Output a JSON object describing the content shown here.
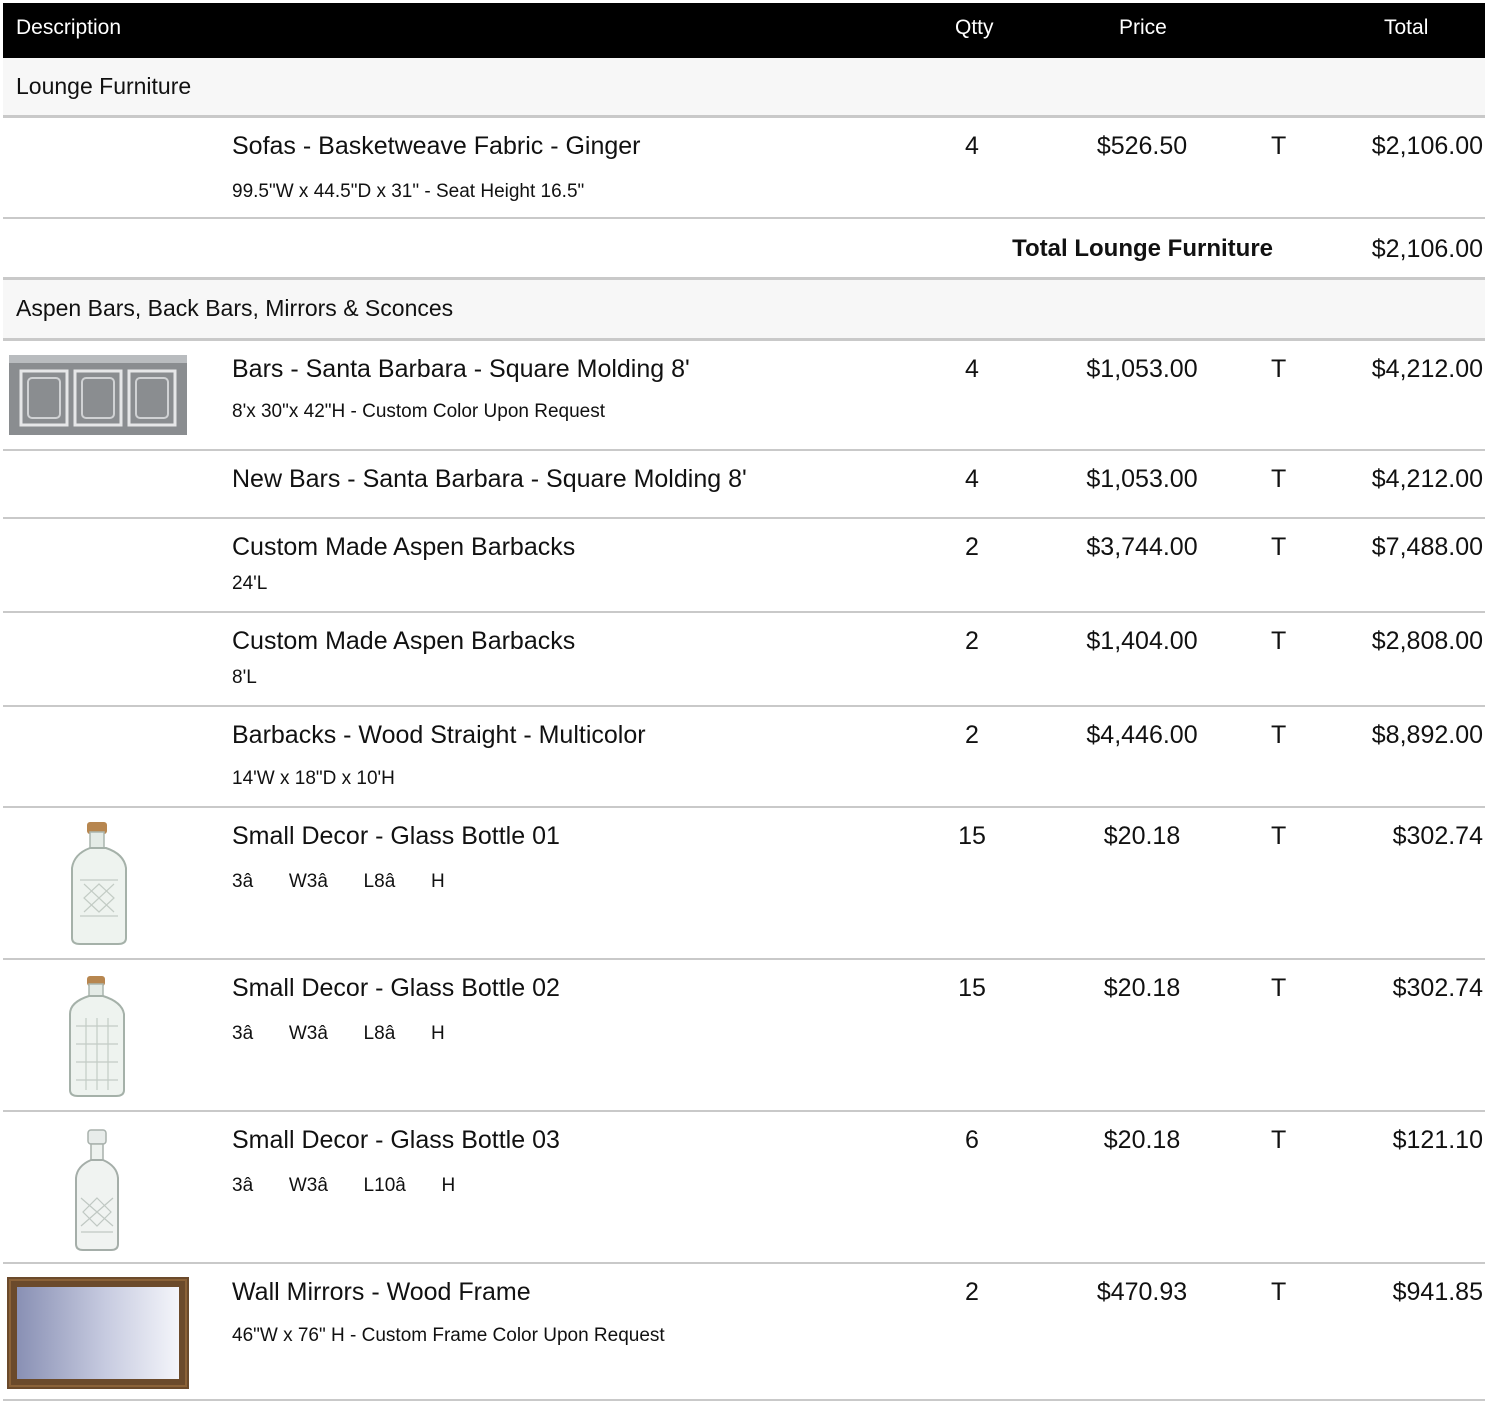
{
  "header": {
    "description": "Description",
    "qty": "Qtty",
    "price": "Price",
    "total": "Total"
  },
  "sections": [
    {
      "title": "Lounge Furniture",
      "items": [
        {
          "name": "Sofas - Basketweave Fabric - Ginger",
          "dims": "99.5\"W x 44.5\"D x 31\" - Seat Height 16.5\"",
          "qty": "4",
          "price": "$526.50",
          "tax": "T",
          "total": "$2,106.00",
          "image": "none"
        }
      ],
      "subtotal_label": "Total Lounge Furniture",
      "subtotal_value": "$2,106.00"
    },
    {
      "title": "Aspen Bars, Back Bars, Mirrors & Sconces",
      "items": [
        {
          "name": "Bars - Santa Barbara - Square Molding 8'",
          "dims": "8'x 30\"x 42\"H - Custom Color Upon Request",
          "qty": "4",
          "price": "$1,053.00",
          "tax": "T",
          "total": "$4,212.00",
          "image": "grey-bar-with-square-molding"
        },
        {
          "name": "New Bars - Santa Barbara - Square Molding 8'",
          "dims": "",
          "qty": "4",
          "price": "$1,053.00",
          "tax": "T",
          "total": "$4,212.00",
          "image": "none"
        },
        {
          "name": "Custom Made Aspen Barbacks",
          "dims": "24'L",
          "qty": "2",
          "price": "$3,744.00",
          "tax": "T",
          "total": "$7,488.00",
          "image": "none"
        },
        {
          "name": "Custom Made Aspen Barbacks",
          "dims": "8'L",
          "qty": "2",
          "price": "$1,404.00",
          "tax": "T",
          "total": "$2,808.00",
          "image": "none"
        },
        {
          "name": "Barbacks - Wood Straight - Multicolor",
          "dims": "14'W x 18\"D x 10'H",
          "qty": "2",
          "price": "$4,446.00",
          "tax": "T",
          "total": "$8,892.00",
          "image": "none"
        },
        {
          "name": "Small Decor - Glass Bottle 01",
          "dims": "3â W3â L8â H",
          "qty": "15",
          "price": "$20.18",
          "tax": "T",
          "total": "$302.74",
          "image": "glass-bottle-cork"
        },
        {
          "name": "Small Decor - Glass Bottle 02",
          "dims": "3â W3â L8â H",
          "qty": "15",
          "price": "$20.18",
          "tax": "T",
          "total": "$302.74",
          "image": "glass-bottle-cork-wide"
        },
        {
          "name": "Small Decor - Glass Bottle 03",
          "dims": "3â W3â L10â H",
          "qty": "6",
          "price": "$20.18",
          "tax": "T",
          "total": "$121.10",
          "image": "glass-decanter"
        },
        {
          "name": "Wall Mirrors - Wood Frame",
          "dims": "46\"W  x 76\" H - Custom Frame Color Upon Request",
          "qty": "2",
          "price": "$470.93",
          "tax": "T",
          "total": "$941.85",
          "image": "wood-frame-mirror"
        }
      ]
    }
  ]
}
